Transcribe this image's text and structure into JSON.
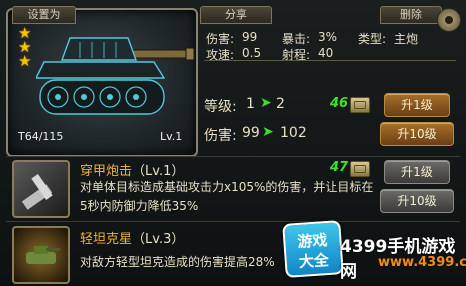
{
  "header": {
    "set_label": "设置为",
    "share_label": "分享",
    "delete_label": "删除"
  },
  "tank": {
    "stars": 3,
    "progress": "T64/115",
    "level": "Lv.1"
  },
  "stats": {
    "damage_label": "伤害:",
    "damage_value": "99",
    "crit_label": "暴击:",
    "crit_value": "3%",
    "type_label": "类型:",
    "type_value": "主炮",
    "speed_label": "攻速:",
    "speed_value": "0.5",
    "range_label": "射程:",
    "range_value": "40"
  },
  "upgrade": {
    "level_label": "等级:",
    "level_from": "1",
    "level_to": "2",
    "level_cost": "46",
    "damage_label": "伤害:",
    "damage_from": "99",
    "damage_to": "102",
    "btn_1": "升1级",
    "btn_10": "升10级"
  },
  "skills": [
    {
      "name": "穿甲炮击",
      "level": "（Lv.1）",
      "cost": "47",
      "desc": "对单体目标造成基础攻击力x105%的伤害，并让目标在5秒内防御力降低35%",
      "btn_1": "升1级",
      "btn_10": "升10级"
    },
    {
      "name": "轻坦克星",
      "level": "（Lv.3）",
      "desc": "对敌方轻型坦克造成的伤害提高28%"
    }
  ],
  "watermark": {
    "badge_top": "游戏",
    "badge_bottom": "大全",
    "title": "4399手机游戏网",
    "url": "www.4399.cn"
  },
  "colors": {
    "accent_green": "#3fe02a",
    "skill_name": "#f2b233",
    "button_orange": "#a8702a",
    "button_gray": "#6c6b68"
  }
}
